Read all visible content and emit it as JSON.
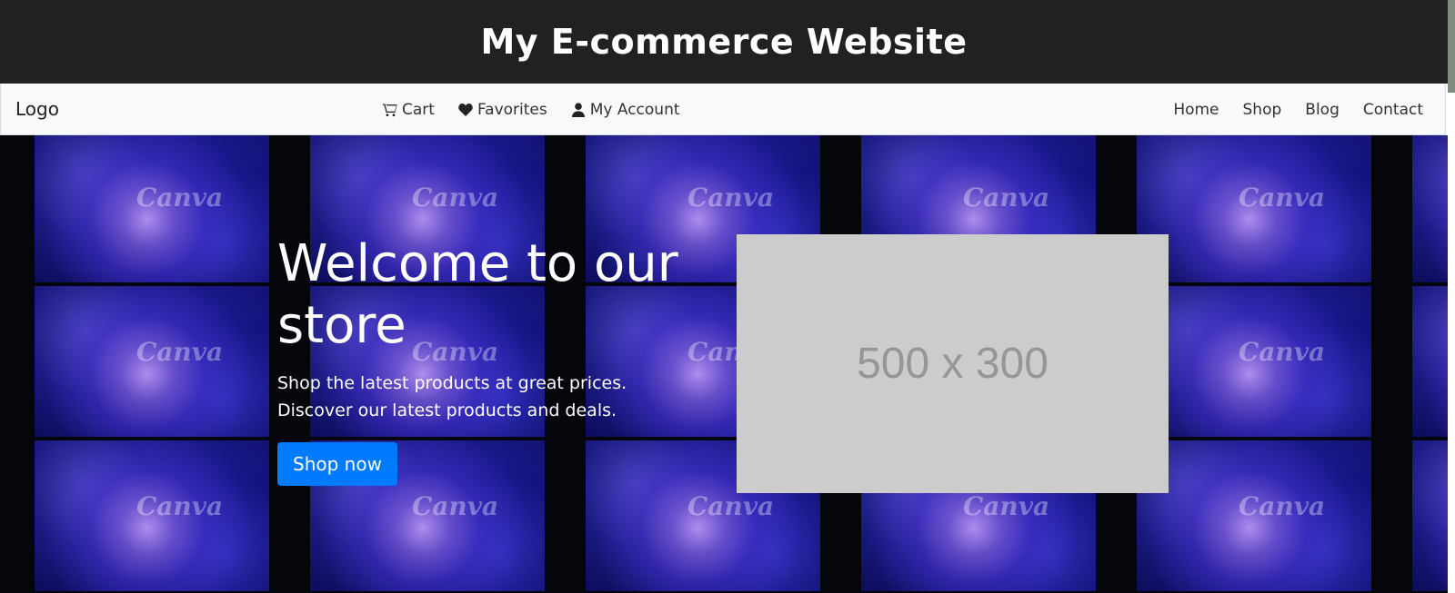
{
  "header": {
    "title": "My E-commerce Website"
  },
  "navbar": {
    "brand": "Logo",
    "center_items": [
      {
        "label": "Cart",
        "icon": "cart-icon"
      },
      {
        "label": "Favorites",
        "icon": "heart-icon"
      },
      {
        "label": "My Account",
        "icon": "user-icon"
      }
    ],
    "right_links": [
      "Home",
      "Shop",
      "Blog",
      "Contact"
    ]
  },
  "hero": {
    "title": "Welcome to our store",
    "subtitle": "Shop the latest products at great prices. Discover our latest products and deals.",
    "button_label": "Shop now",
    "placeholder_text": "500 x 300",
    "watermark_text": "Canva"
  },
  "colors": {
    "header_bg": "#212121",
    "navbar_bg": "#f8f9fa",
    "button": "#007bff",
    "placeholder_bg": "#cccccc"
  }
}
